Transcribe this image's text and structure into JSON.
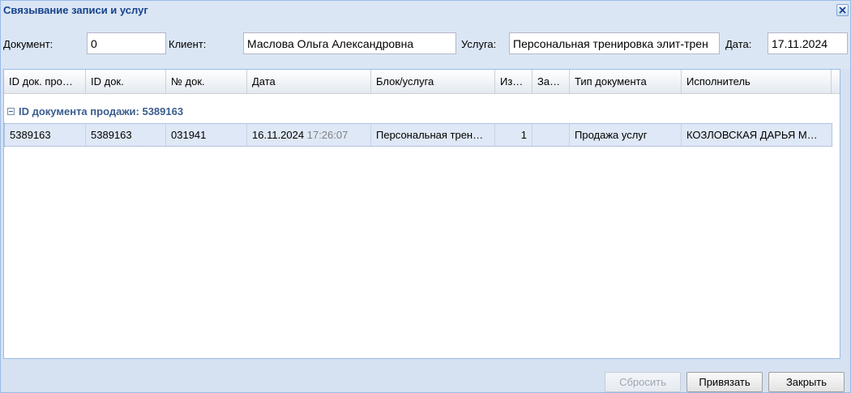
{
  "window": {
    "title": "Связывание записи и услуг"
  },
  "filters": {
    "document_label": "Документ:",
    "document_value": "0",
    "client_label": "Клиент:",
    "client_value": "Маслова  Ольга Александровна",
    "service_label": "Услуга:",
    "service_value": "Персональная тренировка элит-трен",
    "date_label": "Дата:",
    "date_value": "17.11.2024"
  },
  "grid": {
    "columns": [
      "ID док. про…",
      "ID док.",
      "№ док.",
      "Дата",
      "Блок/услуга",
      "Из…",
      "За…",
      "Тип документа",
      "Исполнитель"
    ],
    "group_label": "ID документа продажи: 5389163",
    "rows": [
      {
        "id_sale": "5389163",
        "id_doc": "5389163",
        "doc_no": "031941",
        "date": "16.11.2024",
        "time": "17:26:07",
        "service": "Персональная трен…",
        "qty": "1",
        "za": "",
        "doc_type": "Продажа услуг",
        "performer": "КОЗЛОВСКАЯ ДАРЬЯ М…"
      }
    ]
  },
  "footer": {
    "reset_label": "Сбросить",
    "link_label": "Привязать",
    "close_label": "Закрыть"
  },
  "colors": {
    "title_text": "#15428b",
    "window_bg": "#d6e2f1",
    "selected_row": "#dfe8f6",
    "group_text": "#3a5d8f"
  },
  "icons": {
    "close": "close-icon",
    "group_toggle": "collapse-minus-icon"
  }
}
